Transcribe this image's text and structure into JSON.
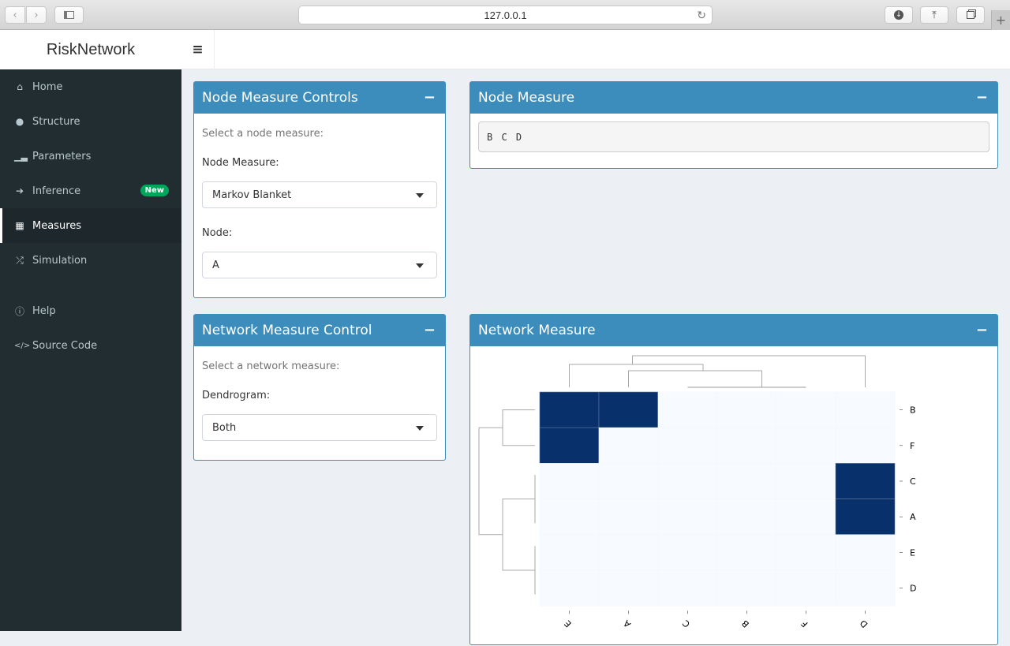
{
  "browser": {
    "url": "127.0.0.1",
    "back_icon": "chevron-left-icon",
    "forward_icon": "chevron-right-icon",
    "sidebar_icon": "sidebar-icon",
    "reload_icon": "reload-icon",
    "download_icon": "download-icon",
    "share_icon": "share-icon",
    "tabs_icon": "tabs-icon",
    "new_tab_icon": "plus-icon"
  },
  "app": {
    "title": "RiskNetwork",
    "toggle_icon": "hamburger-icon"
  },
  "sidebar": {
    "items": [
      {
        "label": "Home",
        "icon": "home-icon"
      },
      {
        "label": "Structure",
        "icon": "globe-icon"
      },
      {
        "label": "Parameters",
        "icon": "bar-chart-icon"
      },
      {
        "label": "Inference",
        "icon": "arrow-right-icon",
        "badge": "New"
      },
      {
        "label": "Measures",
        "icon": "table-icon",
        "active": true
      },
      {
        "label": "Simulation",
        "icon": "random-icon"
      },
      {
        "label": "Help",
        "icon": "info-circle-icon"
      },
      {
        "label": "Source Code",
        "icon": "code-icon"
      }
    ],
    "badge_color": "#00a65a"
  },
  "node_controls": {
    "title": "Node Measure Controls",
    "help": "Select a node measure:",
    "measure_label": "Node Measure:",
    "measure_value": "Markov Blanket",
    "node_label": "Node:",
    "node_value": "A"
  },
  "node_measure": {
    "title": "Node Measure",
    "output": "B C D"
  },
  "network_controls": {
    "title": "Network Measure Control",
    "help": "Select a network measure:",
    "dendrogram_label": "Dendrogram:",
    "dendrogram_value": "Both"
  },
  "network_measure": {
    "title": "Network Measure"
  },
  "colors": {
    "box_header": "#3c8dbc",
    "sidebar_bg": "#222d32",
    "heat_high": "#08306b",
    "heat_low": "#f7fbff"
  },
  "chart_data": {
    "type": "heatmap",
    "title": "",
    "columns": [
      "E",
      "A",
      "C",
      "B",
      "F",
      "D"
    ],
    "rows": [
      "B",
      "F",
      "C",
      "A",
      "E",
      "D"
    ],
    "values": [
      [
        1,
        1,
        0,
        0,
        0,
        0
      ],
      [
        1,
        0,
        0,
        0,
        0,
        0
      ],
      [
        0,
        0,
        0,
        0,
        0,
        1
      ],
      [
        0,
        0,
        0,
        0,
        0,
        1
      ],
      [
        0,
        0,
        0,
        0,
        0,
        0
      ],
      [
        0,
        0,
        0,
        0,
        0,
        0
      ]
    ],
    "row_dendrogram": true,
    "column_dendrogram": true,
    "legend": "none",
    "grid": false
  }
}
